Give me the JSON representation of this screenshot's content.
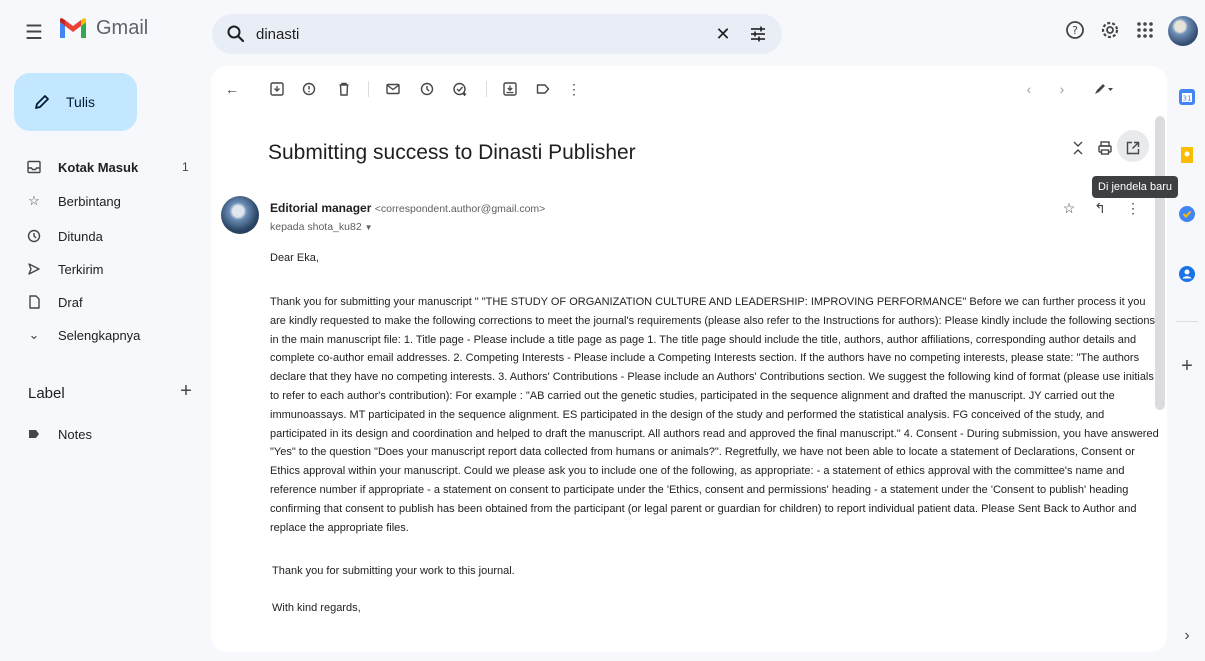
{
  "app": {
    "name": "Gmail"
  },
  "search": {
    "query": "dinasti"
  },
  "compose": {
    "label": "Tulis"
  },
  "nav": [
    {
      "label": "Kotak Masuk",
      "count": "1"
    },
    {
      "label": "Berbintang"
    },
    {
      "label": "Ditunda"
    },
    {
      "label": "Terkirim"
    },
    {
      "label": "Draf"
    },
    {
      "label": "Selengkapnya"
    }
  ],
  "labels": {
    "heading": "Label",
    "items": [
      {
        "label": "Notes"
      }
    ]
  },
  "email": {
    "subject": "Submitting success to Dinasti Publisher",
    "tooltip": "Di jendela baru",
    "sender_name": "Editorial manager",
    "sender_email": "<correspondent.author@gmail.com>",
    "recipient": "kepada shota_ku82",
    "greeting": "Dear Eka,",
    "body": "Thank you for submitting your manuscript \" \"THE STUDY OF ORGANIZATION CULTURE AND LEADERSHIP: IMPROVING PERFORMANCE\" Before we can further process it you are kindly requested to make the following corrections to meet the journal's requirements (please also refer to the Instructions for authors):    Please kindly include the following sections in the main manuscript file:  1. Title page - Please include a title page as page 1. The title page should include the title, authors, author affiliations, corresponding author details and complete co-author email addresses.  2. Competing Interests - Please include a Competing Interests section. If the authors have no competing interests, please state: \"The authors declare that they have no competing interests.  3. Authors' Contributions - Please include an Authors' Contributions section. We suggest the following kind of format (please use initials to refer to each author's contribution):   For example :  \"AB carried out the  genetic studies, participated in the sequence alignment and drafted the manuscript. JY carried out the immunoassays. MT participated in the sequence alignment. ES participated in the design of the study and performed the statistical analysis. FG conceived of the study, and participated in its design and coordination and helped to draft the manuscript. All authors read and approved the final manuscript.\"  4. Consent - During submission, you have answered \"Yes\" to the question \"Does your manuscript report data collected from humans or animals?\". Regretfully, we have not been able to locate a statement of Declarations, Consent or Ethics approval within your manuscript. Could we please ask you to include one of the following, as appropriate:  - a statement of ethics approval with the committee's name and reference number if appropriate  - a statement on consent to participate under the 'Ethics, consent and permissions' heading  - a statement under the 'Consent to publish' heading confirming that consent to publish has been obtained from the participant (or legal parent or guardian for children) to report individual patient data.    Please Sent Back to Author and replace the appropriate files.",
    "thanks": "Thank you for submitting your work to this journal.",
    "closing": "With kind regards,"
  },
  "colors": {
    "compose_bg": "#c2e7ff",
    "search_bg": "#e9eef6",
    "page_bg": "#f6f8fc",
    "gmail_red": "#ea4335",
    "gmail_blue": "#4285f4",
    "gmail_green": "#34a853",
    "gmail_yellow": "#fbbc04"
  },
  "icons": {
    "menu": "hamburger-icon",
    "search": "search-icon",
    "clear": "close-icon",
    "filter": "filter-icon",
    "help": "help-icon",
    "settings": "gear-icon",
    "apps": "apps-grid-icon"
  }
}
